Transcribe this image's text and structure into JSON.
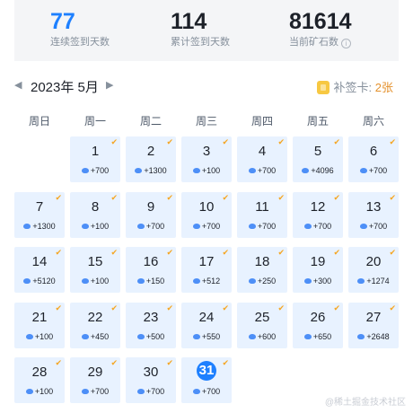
{
  "stats": [
    {
      "value": "77",
      "label": "连续签到天数",
      "highlight": true,
      "info": false
    },
    {
      "value": "114",
      "label": "累计签到天数",
      "highlight": false,
      "info": false
    },
    {
      "value": "81614",
      "label": "当前矿石数",
      "highlight": false,
      "info": true
    }
  ],
  "calendar": {
    "prev_arrow": "◀",
    "next_arrow": "▶",
    "month_label": "2023年 5月",
    "makeup_label": "补签卡: ",
    "makeup_count": "2",
    "makeup_unit": "张",
    "weekdays": [
      "周日",
      "周一",
      "周二",
      "周三",
      "周四",
      "周五",
      "周六"
    ],
    "first_weekday": 1,
    "today": 31,
    "check_mark": "✔",
    "days": [
      {
        "day": "1",
        "reward": "+700"
      },
      {
        "day": "2",
        "reward": "+1300"
      },
      {
        "day": "3",
        "reward": "+100"
      },
      {
        "day": "4",
        "reward": "+700"
      },
      {
        "day": "5",
        "reward": "+4096"
      },
      {
        "day": "6",
        "reward": "+700"
      },
      {
        "day": "7",
        "reward": "+1300"
      },
      {
        "day": "8",
        "reward": "+100"
      },
      {
        "day": "9",
        "reward": "+700"
      },
      {
        "day": "10",
        "reward": "+700"
      },
      {
        "day": "11",
        "reward": "+700"
      },
      {
        "day": "12",
        "reward": "+700"
      },
      {
        "day": "13",
        "reward": "+700"
      },
      {
        "day": "14",
        "reward": "+5120"
      },
      {
        "day": "15",
        "reward": "+100"
      },
      {
        "day": "16",
        "reward": "+150"
      },
      {
        "day": "17",
        "reward": "+512"
      },
      {
        "day": "18",
        "reward": "+250"
      },
      {
        "day": "19",
        "reward": "+300"
      },
      {
        "day": "20",
        "reward": "+1274"
      },
      {
        "day": "21",
        "reward": "+100"
      },
      {
        "day": "22",
        "reward": "+450"
      },
      {
        "day": "23",
        "reward": "+500"
      },
      {
        "day": "24",
        "reward": "+550"
      },
      {
        "day": "25",
        "reward": "+600"
      },
      {
        "day": "26",
        "reward": "+650"
      },
      {
        "day": "27",
        "reward": "+2648"
      },
      {
        "day": "28",
        "reward": "+100"
      },
      {
        "day": "29",
        "reward": "+700"
      },
      {
        "day": "30",
        "reward": "+700"
      },
      {
        "day": "31",
        "reward": "+700"
      }
    ]
  },
  "watermark": "@稀土掘金技术社区",
  "colors": {
    "accent": "#1e80ff",
    "cell_bg": "#e8f2ff",
    "check": "#f5a623",
    "card": "#e4912c"
  }
}
